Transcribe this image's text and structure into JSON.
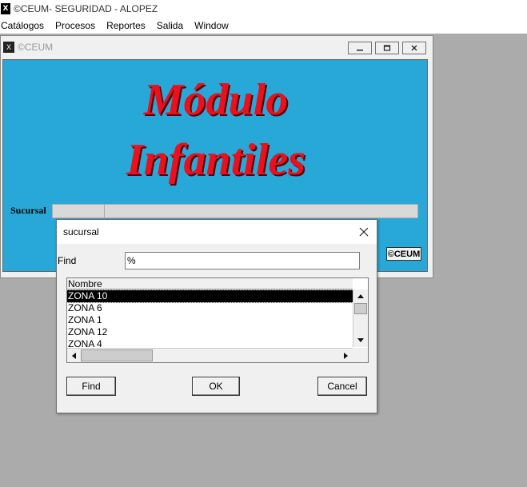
{
  "app": {
    "title": "©CEUM- SEGURIDAD - ALOPEZ",
    "icon": "app-icon"
  },
  "menu": {
    "items": [
      "Catálogos",
      "Procesos",
      "Reportes",
      "Salida",
      "Window"
    ]
  },
  "child_window": {
    "title": "©CEUM",
    "heading_line1": "Módulo",
    "heading_line2": "Infantiles",
    "sucursal_label": "Sucursal",
    "badge": "©CEUM",
    "colors": {
      "background": "#2fb6e6",
      "heading": "#e8121f"
    }
  },
  "dialog": {
    "title": "sucursal",
    "find_label": "Find",
    "find_value": "%",
    "list_header": "Nombre",
    "rows": [
      "ZONA 10",
      "ZONA 6",
      "ZONA 1",
      "ZONA 12",
      "ZONA 4"
    ],
    "selected_index": 0,
    "buttons": {
      "find": "Find",
      "ok": "OK",
      "cancel": "Cancel"
    }
  }
}
